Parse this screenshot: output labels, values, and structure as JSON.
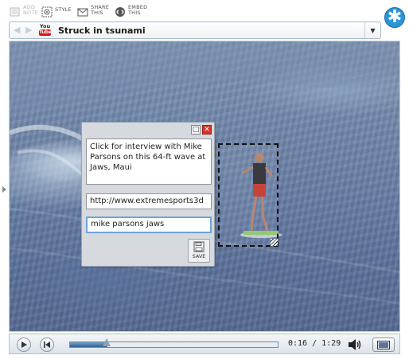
{
  "toolbar": {
    "add_note": "ADD\nNOTE",
    "style": "STYLE",
    "share": "SHARE\nTHIS",
    "embed": "EMBED\nTHIS"
  },
  "header": {
    "yt_you": "You",
    "yt_tube": "Tube",
    "title": "Struck in tsunami",
    "logo_glyph": "✱"
  },
  "note": {
    "text": "Click for interview with Mike Parsons on this 64-ft wave at Jaws, Maui",
    "url": "http://www.extremesports3d",
    "tags": "mike parsons jaws",
    "save_label": "SAVE",
    "close_glyph": "✕",
    "maximize_glyph": "□"
  },
  "player": {
    "time": "0:16 / 1:29",
    "progress": 0.18
  },
  "colors": {
    "accent": "#2b95d6",
    "close": "#d9312b",
    "progress": "#2f5f93"
  },
  "icons": [
    "add-note-icon",
    "style-icon",
    "share-icon",
    "embed-icon",
    "play-icon",
    "rewind-icon",
    "volume-icon",
    "fullscreen-icon",
    "save-icon"
  ]
}
